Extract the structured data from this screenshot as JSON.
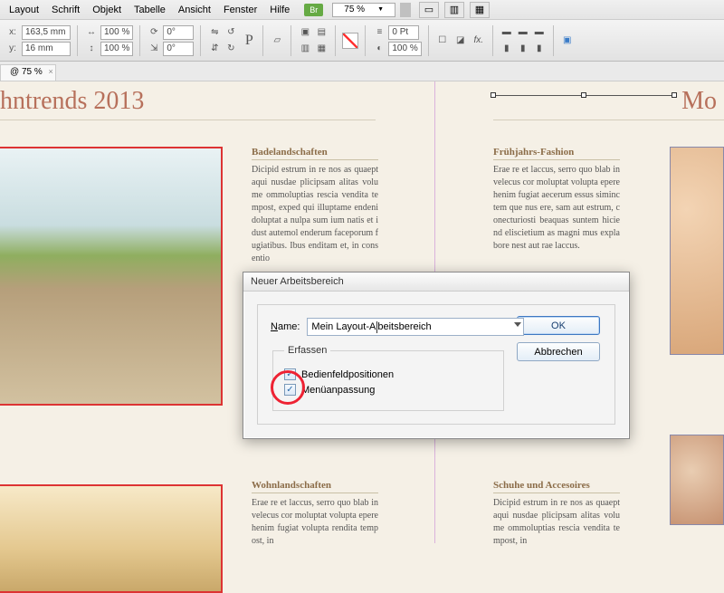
{
  "menu": {
    "items": [
      "Layout",
      "Schrift",
      "Objekt",
      "Tabelle",
      "Ansicht",
      "Fenster",
      "Hilfe"
    ],
    "br": "Br",
    "zoom": "75 %"
  },
  "toolbar": {
    "x": "163,5 mm",
    "y": "16 mm",
    "scalex": "100 %",
    "scaley": "100 %",
    "rotate": "0°",
    "shear": "0°",
    "stroke": "0 Pt",
    "stroke_scale": "100 %"
  },
  "tabs": {
    "label": "75 %"
  },
  "doc": {
    "title_left": "hntrends 2013",
    "title_right": "Mo",
    "blocks": [
      {
        "head": "Badelandschaften",
        "body": "Dicipid estrum in re nos as quaeptaqui nusdae plicipsam alitas volume ommoluptias rescia vendita tempost, exped qui illuptame endeni doluptat a nulpa sum ium natis et idust autemol enderum faceporum fugiatibus.\nIbus enditam et, in consentio"
      },
      {
        "head": "Frühjahrs-Fashion",
        "body": "Erae re et laccus, serro quo blab invelecus cor moluptat volupta eperehenim fugiat aecerum essus siminctem que nus ere, sam aut estrum, conecturiosti beaquas suntem hiciend eliscietium as magni mus explabore nest aut rae laccus."
      },
      {
        "head": "Wohnlandschaften",
        "body": "Erae re et laccus, serro quo blab invelecus cor moluptat volupta eperehenim fugiat volupta rendita tempost, in"
      },
      {
        "head": "Schuhe und Accesoires",
        "body": "Dicipid estrum in re nos as quaeptaqui nusdae plicipsam alitas volume ommoluptias rescia vendita tempost, in"
      }
    ]
  },
  "dialog": {
    "title": "Neuer Arbeitsbereich",
    "name_label_pre": "N",
    "name_label_post": "ame:",
    "name_value_pre": "Mein Layout-A",
    "name_value_post": "beitsbereich",
    "fieldset": "Erfassen",
    "cb1_pre": "B",
    "cb1_post": "edienfeldpositionen",
    "cb2_pre": "M",
    "cb2_post": "enüanpassung",
    "ok": "OK",
    "cancel": "Abbrechen"
  }
}
